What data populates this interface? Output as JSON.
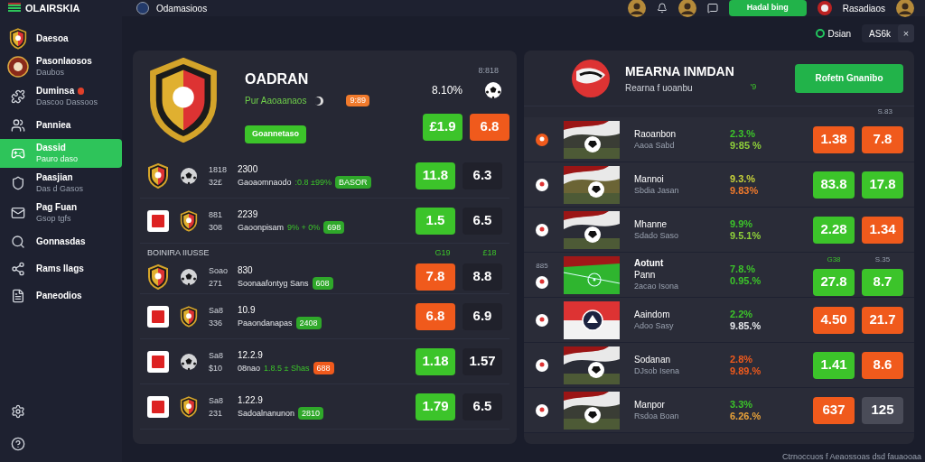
{
  "app": {
    "name": "OLAIRSKIA",
    "section": "Odamasioos"
  },
  "topbar": {
    "button": "Hadal bing",
    "user": "Rasadiaos"
  },
  "filter": {
    "label": "Dsian",
    "chip": "AS6k",
    "close": "×"
  },
  "sidebar": {
    "items": [
      {
        "label": "Daesoa",
        "badge": false,
        "selected": false
      },
      {
        "label": "Pasonlaosos",
        "sub": "Daubos",
        "badge": false,
        "selected": false
      },
      {
        "label": "Duminsa",
        "sub": "Dascoo Dassoos",
        "badge": true,
        "selected": false
      },
      {
        "label": "Panniea",
        "badge": false,
        "selected": false
      },
      {
        "label": "Dassid",
        "sub": "Pauro daso",
        "badge": false,
        "selected": true
      },
      {
        "label": "Paasjian",
        "sub": "Das d Gasos",
        "badge": false,
        "selected": false
      },
      {
        "label": "Pag Fuan",
        "sub": "Gsop tgfs",
        "badge": false,
        "selected": false
      },
      {
        "label": "Gonnasdas",
        "badge": false,
        "selected": false
      },
      {
        "label": "Rams Ilags",
        "badge": false,
        "selected": false
      },
      {
        "label": "Paneodios",
        "badge": false,
        "selected": false
      }
    ]
  },
  "left_panel": {
    "title": "OADRAN",
    "subtitle": "Pur Aaoaanaos",
    "badge": "9:89",
    "small": "8:818",
    "percent": "8.10%",
    "button": "Goannetaso",
    "odds": [
      {
        "text": "£1.9",
        "color": "#3cc42a"
      },
      {
        "text": "6.8",
        "color": "#f05a1c"
      }
    ],
    "groups": [
      {
        "rows": [
          {
            "code": "1818",
            "num": "32£",
            "time": "2300",
            "desc": "Gaoaomnaodo",
            "extra": ":0.8 ±99%",
            "badge": {
              "text": "BASOR",
              "color": "#2fa82a"
            },
            "odds": [
              {
                "text": "11.8",
                "color": "#3cc42a"
              },
              {
                "text": "6.3",
                "color": "#20212b"
              }
            ]
          },
          {
            "code": "881",
            "num": "308",
            "time": "2239",
            "desc": "Gaoonpisam",
            "extra": "9% + 0%",
            "badge": {
              "text": "698",
              "color": "#2fa82a"
            },
            "odds": [
              {
                "text": "1.5",
                "color": "#3cc42a"
              },
              {
                "text": "6.5",
                "color": "#20212b"
              }
            ]
          }
        ]
      },
      {
        "label": "BOINIRA IIUSSE",
        "headers": [
          "G19",
          "£18"
        ],
        "rows": [
          {
            "code": "Soao",
            "num": "271",
            "time": "830",
            "desc": "Soonaafontyg Sans",
            "badge": {
              "text": "608",
              "color": "#2fa82a"
            },
            "odds": [
              {
                "text": "7.8",
                "color": "#f05a1c"
              },
              {
                "text": "8.8",
                "color": "#20212b"
              }
            ]
          },
          {
            "code": "Sa8",
            "num": "336",
            "time": "10.9",
            "desc": "Paaondanapas",
            "badge": {
              "text": "2408",
              "color": "#2fa82a"
            },
            "odds": [
              {
                "text": "6.8",
                "color": "#f05a1c"
              },
              {
                "text": "6.9",
                "color": "#20212b"
              }
            ]
          },
          {
            "code": "Sa8",
            "num": "$10",
            "time": "12.2.9",
            "desc": "08nao",
            "extra": "1.8.5 ± Shas",
            "badge": {
              "text": "688",
              "color": "#f05a1c"
            },
            "odds": [
              {
                "text": "1.18",
                "color": "#3cc42a"
              },
              {
                "text": "1.57",
                "color": "#20212b"
              }
            ]
          },
          {
            "code": "Sa8",
            "num": "231",
            "time": "1.22.9",
            "desc": "Sadoalnanunon",
            "badge": {
              "text": "2810",
              "color": "#2fa82a"
            },
            "odds": [
              {
                "text": "1.79",
                "color": "#3cc42a"
              },
              {
                "text": "6.5",
                "color": "#20212b"
              }
            ]
          }
        ]
      }
    ]
  },
  "right_panel": {
    "title": "MEARNA INMDAN",
    "subtitle": "Rearna f uoanbu",
    "mark": "'9",
    "button": "Rofetn Gnanibo",
    "header": "S.83",
    "rows": [
      {
        "name": "Raoanbon",
        "sub": "Aaoa Sabd",
        "stats": [
          {
            "text": "2.3.%",
            "color": "#3cc42a"
          },
          {
            "text": "9:85 %",
            "color": "#8fd13a"
          }
        ],
        "odds": [
          {
            "text": "1.38",
            "color": "#f05a1c"
          },
          {
            "text": "7.8",
            "color": "#f05a1c"
          }
        ]
      },
      {
        "name": "Mannoi",
        "sub": "Sbdia Jasan",
        "stats": [
          {
            "text": "9.3.%",
            "color": "#c8d43a"
          },
          {
            "text": "9.83%",
            "color": "#f07a2c"
          }
        ],
        "odds": [
          {
            "text": "83.8",
            "color": "#3cc42a"
          },
          {
            "text": "17.8",
            "color": "#3cc42a"
          }
        ]
      },
      {
        "name": "Mhanne",
        "sub": "Sdado Saso",
        "stats": [
          {
            "text": "9.9%",
            "color": "#3cc42a"
          },
          {
            "text": "9.5.1%",
            "color": "#8fd13a"
          }
        ],
        "odds": [
          {
            "text": "2.28",
            "color": "#3cc42a"
          },
          {
            "text": "1.34",
            "color": "#f05a1c"
          }
        ]
      },
      {
        "label": "885",
        "headers": [
          "G38",
          "S.35"
        ],
        "title": "Aotunt",
        "name": "Pann",
        "sub": "2acao Isona",
        "stats": [
          {
            "text": "7.8.%",
            "color": "#3cc42a"
          },
          {
            "text": "0.95.%",
            "color": "#3cc42a"
          }
        ],
        "odds": [
          {
            "text": "27.8",
            "color": "#3cc42a"
          },
          {
            "text": "8.7",
            "color": "#3cc42a"
          }
        ]
      },
      {
        "name": "Aaindom",
        "sub": "Adoo Sasy",
        "stats": [
          {
            "text": "2.2%",
            "color": "#3cc42a"
          },
          {
            "text": "9.85.%",
            "color": "#e5e7eb"
          }
        ],
        "odds": [
          {
            "text": "4.50",
            "color": "#f05a1c"
          },
          {
            "text": "21.7",
            "color": "#f05a1c"
          }
        ]
      },
      {
        "name": "Sodanan",
        "sub": "DJsob Isena",
        "stats": [
          {
            "text": "2.8%",
            "color": "#f05a1c"
          },
          {
            "text": "9.89.%",
            "color": "#f05a1c"
          }
        ],
        "odds": [
          {
            "text": "1.41",
            "color": "#3cc42a"
          },
          {
            "text": "8.6",
            "color": "#f05a1c"
          }
        ]
      },
      {
        "name": "Manpor",
        "sub": "Rsdoa Boan",
        "stats": [
          {
            "text": "3.3%",
            "color": "#3cc42a"
          },
          {
            "text": "6.26.%",
            "color": "#e8a23a"
          }
        ],
        "odds": [
          {
            "text": "637",
            "color": "#f05a1c"
          },
          {
            "text": "125",
            "color": "#4a4c58"
          }
        ]
      }
    ]
  },
  "footer": "Ctrnoccuos f Aeaossoas dsd fauaooaa"
}
